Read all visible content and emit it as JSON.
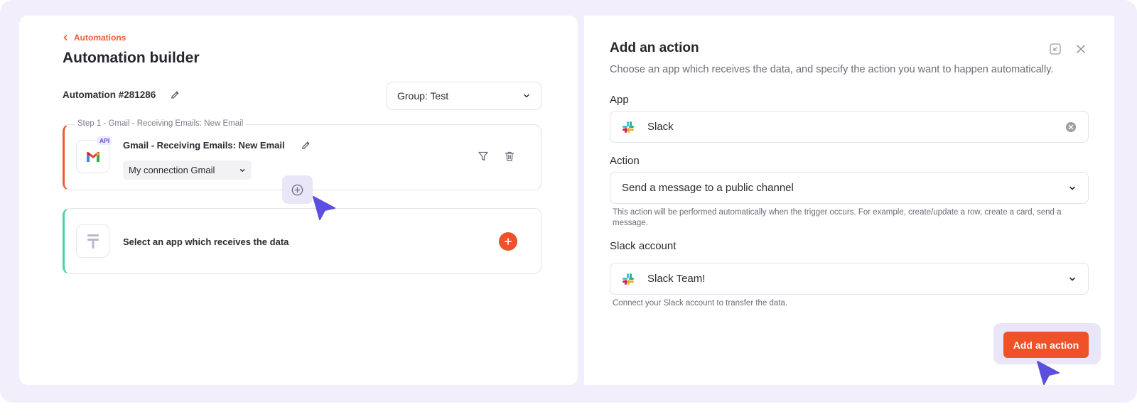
{
  "breadcrumb": {
    "label": "Automations"
  },
  "builder": {
    "title": "Automation builder",
    "automation_id": "Automation #281286",
    "group": "Group: Test"
  },
  "step1": {
    "legend": "Step 1 - Gmail - Receiving Emails: New Email",
    "badge": "API",
    "title": "Gmail - Receiving Emails: New Email",
    "connection": "My connection Gmail"
  },
  "step2": {
    "text": "Select an app which receives the data"
  },
  "action_panel": {
    "title": "Add an action",
    "description": "Choose an app which receives the data, and specify the action you want to happen automatically.",
    "app": {
      "label": "App",
      "value": "Slack"
    },
    "action": {
      "label": "Action",
      "value": "Send a message to a public channel",
      "hint": "This action will be performed automatically when the trigger occurs. For example, create/update a row, create a card, send a message."
    },
    "account": {
      "label": "Slack account",
      "value": "Slack Team!",
      "hint": "Connect your Slack account to transfer the data."
    },
    "submit_label": "Add an action"
  },
  "colors": {
    "accent": "#ef5128",
    "cursor": "#5b4fe0",
    "step_trigger_border": "#ef5a33",
    "step_action_border": "#48d3a6",
    "background": "#f3eefb"
  },
  "icons": [
    "chevron-left-icon",
    "pencil-icon",
    "chevron-down-icon",
    "gmail-icon",
    "filter-icon",
    "trash-icon",
    "plus-circle-icon",
    "placeholder-app-icon",
    "plus-icon",
    "collapse-icon",
    "close-icon",
    "slack-icon",
    "clear-icon",
    "cursor-icon"
  ]
}
